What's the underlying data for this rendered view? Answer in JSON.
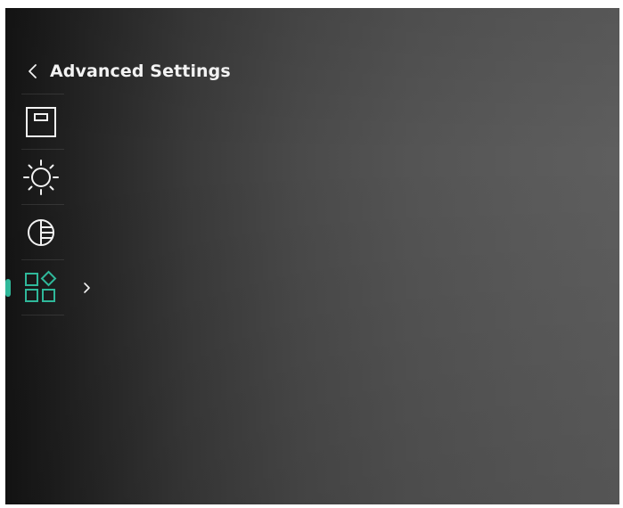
{
  "header": {
    "title": "Advanced Settings",
    "back_icon": "chevron-left-icon"
  },
  "menu": {
    "items": [
      {
        "icon": "display-mode-icon",
        "active": false
      },
      {
        "icon": "brightness-icon",
        "active": false
      },
      {
        "icon": "contrast-icon",
        "active": false
      },
      {
        "icon": "function-settings-icon",
        "active": true,
        "has_submenu": true
      }
    ]
  },
  "colors": {
    "accent": "#2fb89a",
    "icon": "#f2f2f2",
    "text": "#f2f2f2"
  }
}
